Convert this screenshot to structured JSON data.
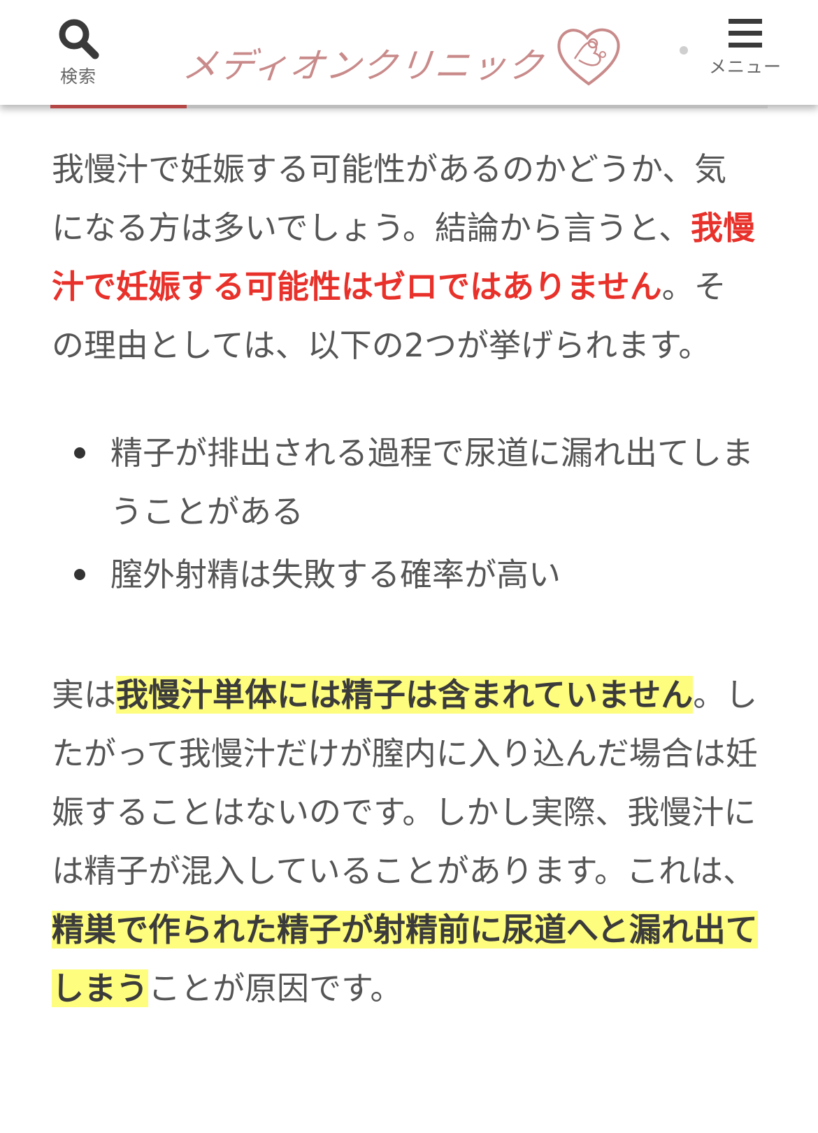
{
  "header": {
    "search_label": "検索",
    "logo_text": "メディオンクリニック",
    "menu_label": "メニュー"
  },
  "progress": {
    "fraction": 0.19
  },
  "colors": {
    "accent": "#b44646",
    "emphasis_red": "#e8312a",
    "highlight": "#fefd7e",
    "body_text": "#555555"
  },
  "icons": {
    "search": "search-icon",
    "logo": "heart-logo-icon",
    "menu": "hamburger-menu-icon"
  },
  "article": {
    "p1": {
      "t1": "我慢汁で妊娠する可能性があるのかどうか、気になる方は多いでしょう。結論から言うと、",
      "red": "我慢汁で妊娠する可能性はゼロではありません",
      "t2": "。その理由としては、以下の2つが挙げられます。"
    },
    "bullets": [
      "精子が排出される過程で尿道に漏れ出てしまうことがある",
      "膣外射精は失敗する確率が高い"
    ],
    "p2": {
      "t1": "実は",
      "hl1": "我慢汁単体には精子は含まれていません",
      "t2": "。したがって我慢汁だけが膣内に入り込んだ場合は妊娠することはないのです。しかし実際、我慢汁には精子が混入していることがあります。これは、",
      "hl2": "精巣で作られた精子が射精前に尿道へと漏れ出てしまう",
      "t3": "ことが原因です。"
    }
  }
}
